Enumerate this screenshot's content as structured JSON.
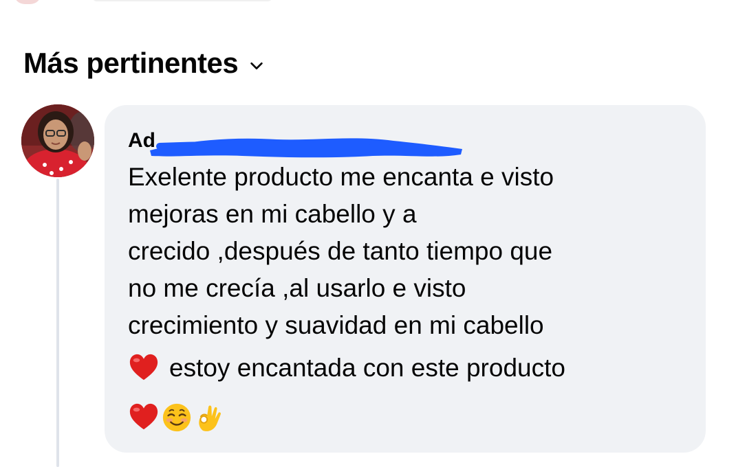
{
  "sort": {
    "label": "Más pertinentes",
    "icon": "chevron-down-icon"
  },
  "comment": {
    "author_visible_prefix": "Ad",
    "author_redacted": true,
    "text_lines": [
      "Exelente producto me encanta e visto",
      "mejoras en mi cabello y a",
      "crecido ,después de tanto tiempo que",
      "no me crecía ,al usarlo e visto",
      "crecimiento y suavidad en mi cabello"
    ],
    "emoji_line_text": "estoy encantada con este producto",
    "emoji_line_icon": "red-heart-icon",
    "reaction_emojis": [
      "red-heart-icon",
      "smiling-face-icon",
      "ok-hand-icon"
    ]
  },
  "colors": {
    "bubble_background": "#f0f2f5",
    "text": "#050505",
    "redaction": "#1e5cff",
    "thread_line": "#dfe3ea"
  }
}
